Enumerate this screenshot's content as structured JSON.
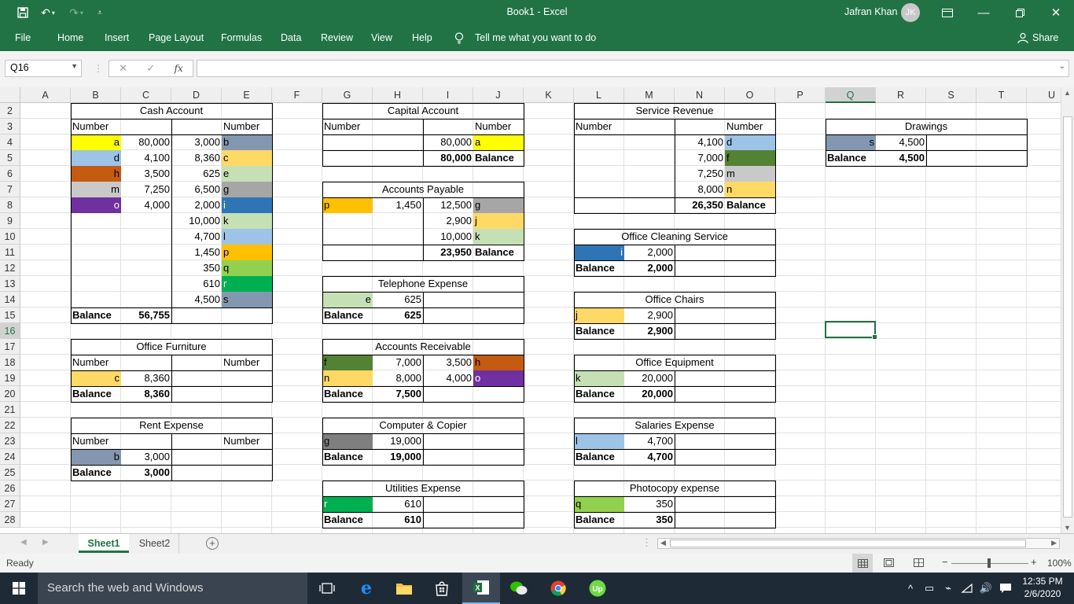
{
  "window": {
    "title": "Book1  -  Excel",
    "user": "Jafran Khan",
    "user_initials": "JK"
  },
  "ribbon": {
    "tabs": [
      "File",
      "Home",
      "Insert",
      "Page Layout",
      "Formulas",
      "Data",
      "Review",
      "View",
      "Help"
    ],
    "tell_me": "Tell me what you want to do",
    "share": "Share"
  },
  "formula_bar": {
    "name_box": "Q16",
    "fx_label": "fx",
    "formula": ""
  },
  "grid": {
    "columns": [
      "A",
      "B",
      "C",
      "D",
      "E",
      "F",
      "G",
      "H",
      "I",
      "J",
      "K",
      "L",
      "M",
      "N",
      "O",
      "P",
      "Q",
      "R",
      "S",
      "T",
      "U"
    ],
    "rows": [
      "2",
      "3",
      "4",
      "5",
      "6",
      "7",
      "8",
      "9",
      "10",
      "11",
      "12",
      "13",
      "14",
      "15",
      "16",
      "17",
      "18",
      "19",
      "20",
      "21",
      "22",
      "23",
      "24",
      "25",
      "26",
      "27",
      "28"
    ],
    "selected_column": "Q",
    "selected_row": "16"
  },
  "colors": {
    "yellow": "#ffff00",
    "light_blue": "#9dc3e6",
    "orange_dark": "#c55a11",
    "gray": "#c9c9c9",
    "purple": "#7030a0",
    "steel": "#8497b0",
    "gold": "#ffd966",
    "light_green": "#c5e0b4",
    "gray_mid": "#a6a6a6",
    "blue": "#2e75b6",
    "orange": "#ffc000",
    "green_lime": "#92d050",
    "green": "#00b050",
    "olive_green": "#548235",
    "dark_gray": "#7f7f7f",
    "accent": "#217346"
  },
  "cells": {
    "cash_title": "Cash Account",
    "cash_hdr_left": "Number",
    "cash_hdr_right": "Number",
    "cash_l": [
      {
        "code": "a",
        "amount": "80,000"
      },
      {
        "code": "d",
        "amount": "4,100"
      },
      {
        "code": "h",
        "amount": "3,500"
      },
      {
        "code": "m",
        "amount": "7,250"
      },
      {
        "code": "o",
        "amount": "4,000"
      }
    ],
    "cash_r": [
      {
        "amount": "3,000",
        "code": "b"
      },
      {
        "amount": "8,360",
        "code": "c"
      },
      {
        "amount": "625",
        "code": "e"
      },
      {
        "amount": "6,500",
        "code": "g"
      },
      {
        "amount": "2,000",
        "code": "i"
      },
      {
        "amount": "10,000",
        "code": "k"
      },
      {
        "amount": "4,700",
        "code": "l"
      },
      {
        "amount": "1,450",
        "code": "p"
      },
      {
        "amount": "350",
        "code": "q"
      },
      {
        "amount": "610",
        "code": "r"
      },
      {
        "amount": "4,500",
        "code": "s"
      }
    ],
    "cash_balance_label": "Balance",
    "cash_balance": "56,755",
    "capital_title": "Capital Account",
    "capital_hdr_left": "Number",
    "capital_hdr_right": "Number",
    "capital_amount": "80,000",
    "capital_code": "a",
    "capital_total": "80,000",
    "capital_balance_label": "Balance",
    "ap_title": "Accounts Payable",
    "ap_l_code": "p",
    "ap_l_amount": "1,450",
    "ap_r": [
      {
        "amount": "12,500",
        "code": "g"
      },
      {
        "amount": "2,900",
        "code": "j"
      },
      {
        "amount": "10,000",
        "code": "k"
      }
    ],
    "ap_total": "23,950",
    "ap_balance_label": "Balance",
    "tel_title": "Telephone Expense",
    "tel_code": "e",
    "tel_amount": "625",
    "tel_balance_label": "Balance",
    "tel_balance": "625",
    "ar_title": "Accounts Receivable",
    "ar_l": [
      {
        "code": "f",
        "amount": "7,000"
      },
      {
        "code": "n",
        "amount": "8,000"
      }
    ],
    "ar_r": [
      {
        "amount": "3,500",
        "code": "h"
      },
      {
        "amount": "4,000",
        "code": "o"
      }
    ],
    "ar_balance_label": "Balance",
    "ar_balance": "7,500",
    "cc_title": "Computer & Copier",
    "cc_code": "g",
    "cc_amount": "19,000",
    "cc_balance_label": "Balance",
    "cc_balance": "19,000",
    "util_title": "Utilities Expense",
    "util_code": "r",
    "util_amount": "610",
    "util_balance_label": "Balance",
    "util_balance": "610",
    "sr_title": "Service Revenue",
    "sr_hdr_left": "Number",
    "sr_hdr_right": "Number",
    "sr_r": [
      {
        "amount": "4,100",
        "code": "d"
      },
      {
        "amount": "7,000",
        "code": "f"
      },
      {
        "amount": "7,250",
        "code": "m"
      },
      {
        "amount": "8,000",
        "code": "n"
      }
    ],
    "sr_total": "26,350",
    "sr_balance_label": "Balance",
    "ocs_title": "Office Cleaning Service",
    "ocs_code": "i",
    "ocs_amount": "2,000",
    "ocs_balance_label": "Balance",
    "ocs_balance": "2,000",
    "oc_title": "Office Chairs",
    "oc_code": "j",
    "oc_amount": "2,900",
    "oc_balance_label": "Balance",
    "oc_balance": "2,900",
    "oe_title": "Office Equipment",
    "oe_code": "k",
    "oe_amount": "20,000",
    "oe_balance_label": "Balance",
    "oe_balance": "20,000",
    "sal_title": "Salaries Expense",
    "sal_code": "l",
    "sal_amount": "4,700",
    "sal_balance_label": "Balance",
    "sal_balance": "4,700",
    "photo_title": "Photocopy expense",
    "photo_code": "q",
    "photo_amount": "350",
    "photo_balance_label": "Balance",
    "photo_balance": "350",
    "of_title": "Office Furniture",
    "of_hdr_left": "Number",
    "of_hdr_right": "Number",
    "of_code": "c",
    "of_amount": "8,360",
    "of_balance_label": "Balance",
    "of_balance": "8,360",
    "rent_title": "Rent Expense",
    "rent_hdr_left": "Number",
    "rent_hdr_right": "Number",
    "rent_code": "b",
    "rent_amount": "3,000",
    "rent_balance_label": "Balance",
    "rent_balance": "3,000",
    "draw_title": "Drawings",
    "draw_code": "s",
    "draw_amount": "4,500",
    "draw_balance_label": "Balance",
    "draw_balance": "4,500"
  },
  "sheets": {
    "tabs": [
      "Sheet1",
      "Sheet2"
    ],
    "active": "Sheet1"
  },
  "status": {
    "text": "Ready",
    "zoom": "100%"
  },
  "taskbar": {
    "search_placeholder": "Search the web and Windows",
    "time": "12:35 PM",
    "date": "2/6/2020"
  }
}
